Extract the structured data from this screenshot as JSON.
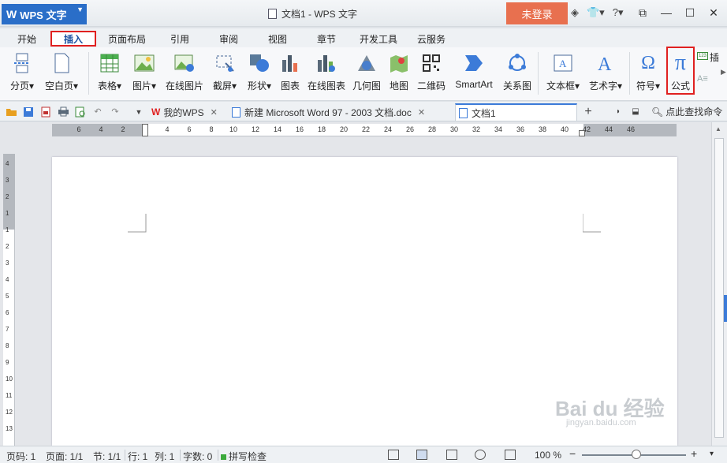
{
  "app": {
    "button_label": "WPS 文字",
    "window_title": "文档1 - WPS 文字",
    "login_label": "未登录",
    "title_icons": [
      "shield-icon",
      "shirt-icon",
      "help-icon"
    ]
  },
  "menu": {
    "tabs": [
      "开始",
      "插入",
      "页面布局",
      "引用",
      "审阅",
      "视图",
      "章节",
      "开发工具",
      "云服务"
    ],
    "active": "插入"
  },
  "ribbon": {
    "items": [
      {
        "label": "分页",
        "dropdown": true,
        "icon": "page-break-icon"
      },
      {
        "label": "空白页",
        "dropdown": true,
        "icon": "blank-page-icon"
      },
      {
        "label": "表格",
        "dropdown": true,
        "icon": "table-icon"
      },
      {
        "label": "图片",
        "dropdown": true,
        "icon": "picture-icon"
      },
      {
        "label": "在线图片",
        "dropdown": false,
        "icon": "online-picture-icon"
      },
      {
        "label": "截屏",
        "dropdown": true,
        "icon": "screenshot-icon"
      },
      {
        "label": "形状",
        "dropdown": true,
        "icon": "shape-icon"
      },
      {
        "label": "图表",
        "dropdown": false,
        "icon": "chart-icon"
      },
      {
        "label": "在线图表",
        "dropdown": false,
        "icon": "online-chart-icon"
      },
      {
        "label": "几何图",
        "dropdown": false,
        "icon": "geometry-icon"
      },
      {
        "label": "地图",
        "dropdown": false,
        "icon": "map-icon"
      },
      {
        "label": "二维码",
        "dropdown": false,
        "icon": "qrcode-icon"
      },
      {
        "label": "SmartArt",
        "dropdown": false,
        "icon": "smartart-icon"
      },
      {
        "label": "关系图",
        "dropdown": false,
        "icon": "relation-icon"
      },
      {
        "label": "文本框",
        "dropdown": true,
        "icon": "textbox-icon"
      },
      {
        "label": "艺术字",
        "dropdown": true,
        "icon": "wordart-icon"
      },
      {
        "label": "符号",
        "dropdown": true,
        "icon": "omega-icon"
      },
      {
        "label": "公式",
        "dropdown": false,
        "icon": "pi-icon"
      }
    ],
    "extra_label": "插"
  },
  "doctabs": [
    {
      "label": "我的WPS",
      "icon": "wps-logo-icon",
      "closable": true,
      "active": false
    },
    {
      "label": "新建 Microsoft Word 97 - 2003 文档.doc",
      "icon": "doc-icon",
      "closable": true,
      "active": false
    },
    {
      "label": "文档1",
      "icon": "doc-icon",
      "closable": false,
      "active": true
    }
  ],
  "search_command": "点此查找命令",
  "ruler": {
    "h_numbers": [
      "6",
      "4",
      "2",
      "2",
      "4",
      "6",
      "8",
      "10",
      "12",
      "14",
      "16",
      "18",
      "20",
      "22",
      "24",
      "26",
      "28",
      "30",
      "32",
      "34",
      "36",
      "38",
      "40",
      "42",
      "44",
      "46"
    ],
    "v_numbers": [
      "4",
      "3",
      "2",
      "1",
      "1",
      "2",
      "3",
      "4",
      "5",
      "6",
      "7",
      "8",
      "9",
      "10",
      "11",
      "12",
      "13"
    ]
  },
  "status": {
    "page_num": "页码: 1",
    "pages": "页面: 1/1",
    "section": "节: 1/1",
    "row": "行: 1",
    "col": "列: 1",
    "words": "字数: 0",
    "spell": "拼写检查",
    "zoom": "100 %"
  },
  "watermark": {
    "main": "Bai du 经验",
    "sub": "jingyan.baidu.com"
  }
}
